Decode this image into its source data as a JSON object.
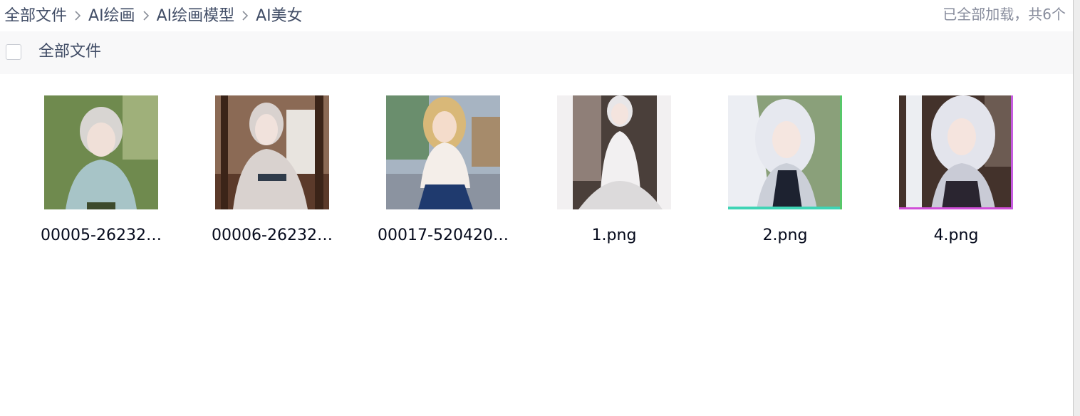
{
  "breadcrumb": {
    "items": [
      {
        "label": "全部文件"
      },
      {
        "label": "AI绘画"
      },
      {
        "label": "AI绘画模型"
      },
      {
        "label": "AI美女"
      }
    ]
  },
  "load_status": "已全部加载，共6个",
  "list_header": {
    "title": "全部文件"
  },
  "files": [
    {
      "name": "00005-26232…",
      "thumb_colors": [
        "#6f8a4e",
        "#a7c4c7",
        "#d8d5d2",
        "#3d4a2c"
      ]
    },
    {
      "name": "00006-26232…",
      "thumb_colors": [
        "#5b3a2a",
        "#d9d2cf",
        "#b8aca6",
        "#2b1d16"
      ]
    },
    {
      "name": "00017-520420…",
      "thumb_colors": [
        "#6a8e6d",
        "#f4eee9",
        "#1f3a6e",
        "#a68b6b"
      ]
    },
    {
      "name": "1.png",
      "thumb_colors": [
        "#4a3f3a",
        "#f2f0f1",
        "#dcdadb",
        "#8f7f78"
      ]
    },
    {
      "name": "2.png",
      "thumb_colors": [
        "#8aa07a",
        "#eceef3",
        "#1d2230",
        "#cbcfd8"
      ]
    },
    {
      "name": "4.png",
      "thumb_colors": [
        "#43322b",
        "#e3e4ec",
        "#c9cbd6",
        "#6c5b52"
      ]
    }
  ],
  "colors": {
    "text_primary": "#424e67",
    "text_secondary": "#878c9c",
    "header_bg": "#f8f8f9"
  }
}
